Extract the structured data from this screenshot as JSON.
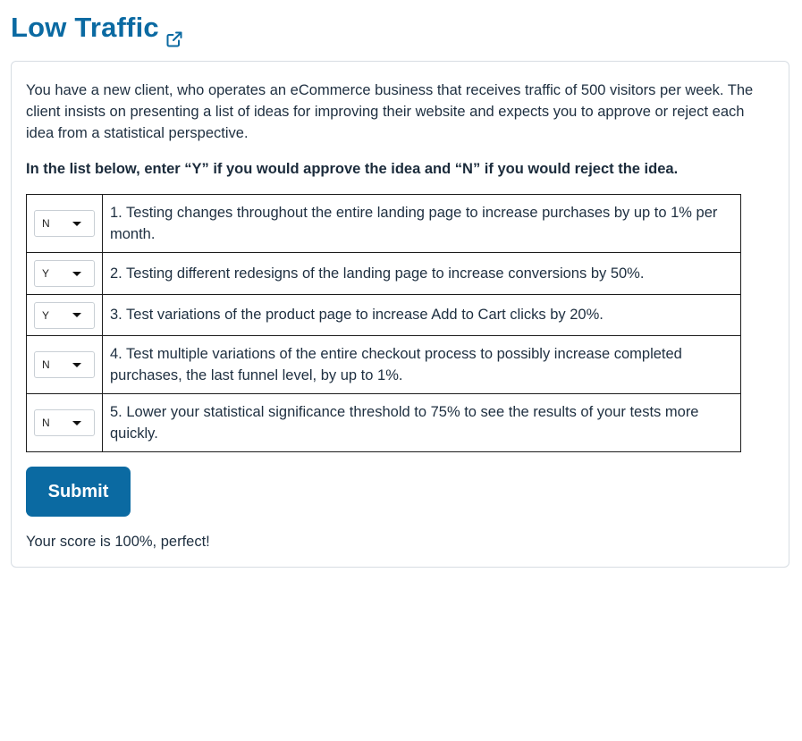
{
  "title": "Low Traffic",
  "intro": "You have a new client, who operates an eCommerce business that receives traffic of 500 visitors per week. The client insists on presenting a list of ideas for improving their website and expects you to approve or reject each idea from a statistical perspective.",
  "instruction": "In the list below, enter “Y” if you would approve the idea and “N” if you would reject the idea.",
  "ideas": [
    {
      "selected": "N",
      "text": "1. Testing changes throughout the entire landing page to increase purchases by up to 1% per month."
    },
    {
      "selected": "Y",
      "text": "2. Testing different redesigns of the landing page to increase conversions by 50%."
    },
    {
      "selected": "Y",
      "text": "3. Test variations of the product page to increase Add to Cart clicks by 20%."
    },
    {
      "selected": "N",
      "text": "4. Test multiple variations of the entire checkout process to possibly increase completed purchases, the last funnel level, by up to 1%."
    },
    {
      "selected": "N",
      "text": "5. Lower your statistical significance threshold to 75% to see the results of your tests more quickly."
    }
  ],
  "submit_label": "Submit",
  "score_text": "Your score is 100%, perfect!",
  "colors": {
    "accent": "#0b6aa2",
    "text": "#1e2f40",
    "border": "#d7dde3"
  },
  "icons": {
    "title_link": "external-link-icon",
    "select": "caret-down-icon"
  }
}
